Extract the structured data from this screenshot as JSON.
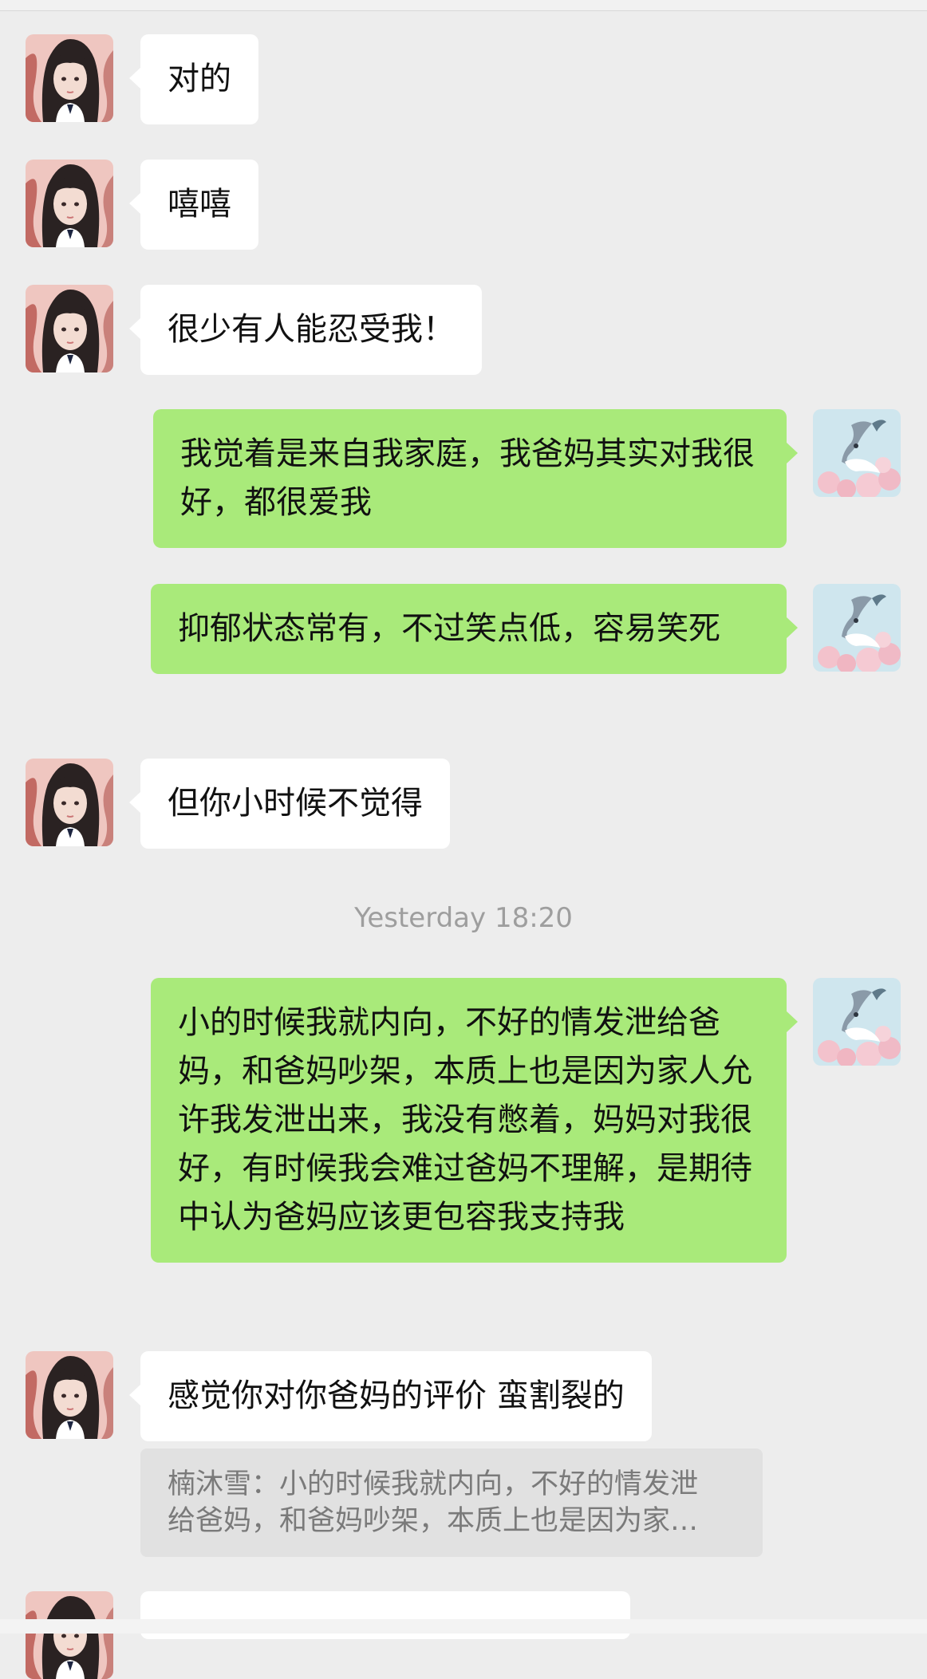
{
  "chat": {
    "messages": [
      {
        "side": "left",
        "text": "对的"
      },
      {
        "side": "left",
        "text": "嘻嘻"
      },
      {
        "side": "left",
        "text": "很少有人能忍受我！"
      },
      {
        "side": "right",
        "text": "我觉着是来自我家庭，我爸妈其实对我很好，都很爱我"
      },
      {
        "side": "right",
        "text": "抑郁状态常有，不过笑点低，容易笑死"
      },
      {
        "side": "left",
        "text": "但你小时候不觉得"
      },
      {
        "side": "right",
        "text": "小的时候我就内向，不好的情发泄给爸妈，和爸妈吵架，本质上也是因为家人允许我发泄出来，我没有憋着，妈妈对我很好，有时候我会难过爸妈不理解，是期待中认为爸妈应该更包容我支持我"
      },
      {
        "side": "left",
        "text": "感觉你对你爸妈的评价 蛮割裂的"
      }
    ],
    "timestamp": "Yesterday 18:20",
    "quote": {
      "line1": "楠沐雪：小的时候我就内向，不好的情发泄",
      "line2": "给爸妈，和爸妈吵架，本质上也是因为家…"
    }
  },
  "colors": {
    "background": "#ededed",
    "bubble_self": "#a9ea7a",
    "bubble_other": "#ffffff",
    "timestamp": "#9e9e9e"
  },
  "icons": {
    "contact_avatar": "portrait-photo-avatar",
    "self_avatar": "anime-art-avatar"
  }
}
